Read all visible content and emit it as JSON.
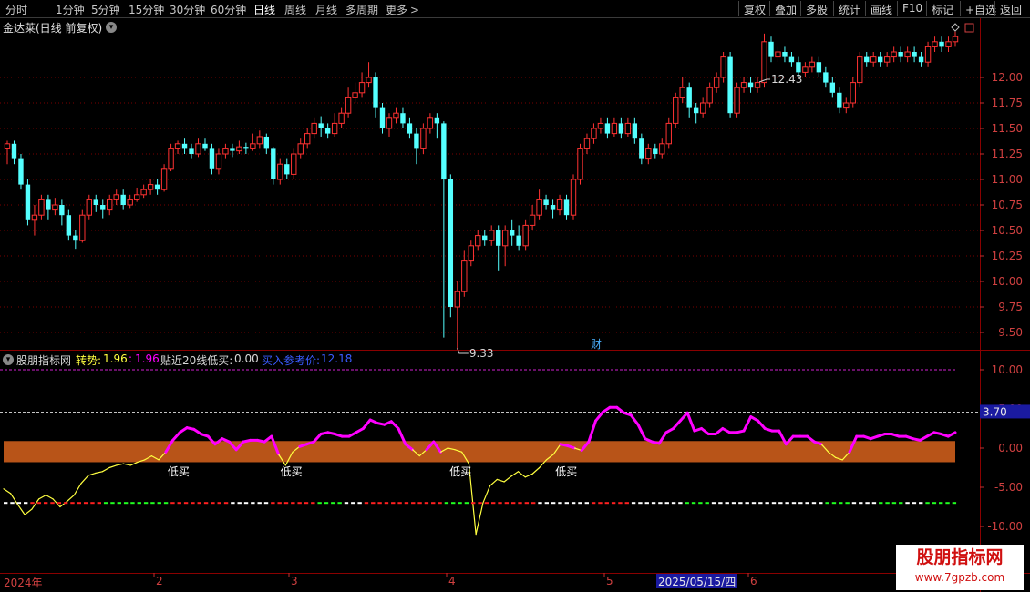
{
  "toolbar": {
    "periods": [
      "分时",
      "1分钟",
      "5分钟",
      "15分钟",
      "30分钟",
      "60分钟",
      "日线",
      "周线",
      "月线",
      "多周期",
      "更多"
    ],
    "active_period": "日线",
    "more_arrow": ">",
    "tools": [
      "复权",
      "叠加",
      "多股",
      "统计",
      "画线",
      "F10",
      "标记",
      "+自选",
      "返回"
    ]
  },
  "stock": {
    "title": "金达莱(日线 前复权)",
    "high_label": "12.43",
    "low_label": "9.33",
    "fin_marker": "财"
  },
  "price_axis": [
    "12.00",
    "11.75",
    "11.50",
    "11.25",
    "11.00",
    "10.75",
    "10.50",
    "10.25",
    "10.00",
    "9.75",
    "9.50"
  ],
  "indicator": {
    "name": "股朋指标网",
    "trend_label": "转势:",
    "trend_value_1": "1.96",
    "trend_sep": ":",
    "trend_value_2": "1.96",
    "near_label": "贴近20线低买:",
    "near_value": "0.00",
    "ref_label": "买入参考价:",
    "ref_value": "12.18",
    "axis": [
      "10.00",
      "5.00",
      "0.00",
      "-5.00",
      "-10.00"
    ],
    "current_value": "3.70",
    "signal_text": "低买"
  },
  "dates": {
    "year": "2024年",
    "months": [
      "2",
      "3",
      "4",
      "5",
      "6"
    ],
    "cursor": "2025/05/15/四"
  },
  "watermark": {
    "title": "股朋指标网",
    "url": "www.7gpzb.com"
  },
  "colors": {
    "up": "#ff3232",
    "down": "#54ffff",
    "trend_up": "#ff00ff",
    "trend_down": "#ffff40",
    "band": "#b85418",
    "grid": "#7a0000"
  },
  "chart_data": {
    "type": "candlestick",
    "price_range": [
      9.3,
      12.5
    ],
    "indicator_range": [
      -12,
      12
    ],
    "candles": [
      [
        11.3,
        11.35,
        11.38,
        11.15
      ],
      [
        11.35,
        11.2,
        11.38,
        11.15
      ],
      [
        11.2,
        10.95,
        11.25,
        10.9
      ],
      [
        10.95,
        10.6,
        11.0,
        10.55
      ],
      [
        10.6,
        10.65,
        10.75,
        10.45
      ],
      [
        10.65,
        10.8,
        10.85,
        10.6
      ],
      [
        10.8,
        10.7,
        10.85,
        10.6
      ],
      [
        10.7,
        10.75,
        10.82,
        10.65
      ],
      [
        10.75,
        10.65,
        10.8,
        10.55
      ],
      [
        10.65,
        10.45,
        10.7,
        10.4
      ],
      [
        10.45,
        10.4,
        10.5,
        10.32
      ],
      [
        10.4,
        10.65,
        10.7,
        10.38
      ],
      [
        10.65,
        10.8,
        10.85,
        10.6
      ],
      [
        10.8,
        10.75,
        10.85,
        10.68
      ],
      [
        10.75,
        10.7,
        10.8,
        10.62
      ],
      [
        10.7,
        10.8,
        10.85,
        10.65
      ],
      [
        10.8,
        10.85,
        10.9,
        10.75
      ],
      [
        10.85,
        10.75,
        10.9,
        10.7
      ],
      [
        10.75,
        10.8,
        10.85,
        10.72
      ],
      [
        10.8,
        10.85,
        10.92,
        10.78
      ],
      [
        10.85,
        10.9,
        10.95,
        10.82
      ],
      [
        10.9,
        10.95,
        11.0,
        10.85
      ],
      [
        10.95,
        10.9,
        11.0,
        10.85
      ],
      [
        10.9,
        11.1,
        11.15,
        10.88
      ],
      [
        11.1,
        11.3,
        11.35,
        11.08
      ],
      [
        11.3,
        11.35,
        11.38,
        11.25
      ],
      [
        11.35,
        11.3,
        11.4,
        11.25
      ],
      [
        11.3,
        11.25,
        11.35,
        11.2
      ],
      [
        11.25,
        11.35,
        11.4,
        11.22
      ],
      [
        11.35,
        11.3,
        11.4,
        11.28
      ],
      [
        11.3,
        11.1,
        11.35,
        11.05
      ],
      [
        11.1,
        11.25,
        11.3,
        11.05
      ],
      [
        11.25,
        11.3,
        11.35,
        11.2
      ],
      [
        11.3,
        11.28,
        11.35,
        11.22
      ],
      [
        11.28,
        11.32,
        11.38,
        11.25
      ],
      [
        11.32,
        11.3,
        11.36,
        11.25
      ],
      [
        11.3,
        11.35,
        11.45,
        11.28
      ],
      [
        11.35,
        11.42,
        11.48,
        11.3
      ],
      [
        11.42,
        11.3,
        11.45,
        11.25
      ],
      [
        11.3,
        11.0,
        11.32,
        10.95
      ],
      [
        11.0,
        11.15,
        11.2,
        10.95
      ],
      [
        11.15,
        11.05,
        11.2,
        11.0
      ],
      [
        11.05,
        11.25,
        11.3,
        11.0
      ],
      [
        11.25,
        11.35,
        11.4,
        11.2
      ],
      [
        11.35,
        11.45,
        11.5,
        11.3
      ],
      [
        11.45,
        11.55,
        11.6,
        11.4
      ],
      [
        11.55,
        11.5,
        11.62,
        11.42
      ],
      [
        11.5,
        11.45,
        11.55,
        11.4
      ],
      [
        11.45,
        11.55,
        11.65,
        11.42
      ],
      [
        11.55,
        11.65,
        11.7,
        11.5
      ],
      [
        11.65,
        11.8,
        11.9,
        11.6
      ],
      [
        11.8,
        11.85,
        11.95,
        11.75
      ],
      [
        11.85,
        11.95,
        12.05,
        11.8
      ],
      [
        11.95,
        12.0,
        12.15,
        11.9
      ],
      [
        12.0,
        11.7,
        12.05,
        11.6
      ],
      [
        11.7,
        11.5,
        11.75,
        11.45
      ],
      [
        11.5,
        11.6,
        11.65,
        11.42
      ],
      [
        11.6,
        11.65,
        11.7,
        11.55
      ],
      [
        11.65,
        11.55,
        11.7,
        11.5
      ],
      [
        11.55,
        11.45,
        11.6,
        11.4
      ],
      [
        11.45,
        11.3,
        11.5,
        11.15
      ],
      [
        11.3,
        11.5,
        11.55,
        11.25
      ],
      [
        11.5,
        11.6,
        11.65,
        11.45
      ],
      [
        11.6,
        11.55,
        11.65,
        11.4
      ],
      [
        11.55,
        11.0,
        11.57,
        9.45
      ],
      [
        11.0,
        9.75,
        11.05,
        9.65
      ],
      [
        9.75,
        9.9,
        10.0,
        9.33
      ],
      [
        9.9,
        10.2,
        10.3,
        9.85
      ],
      [
        10.2,
        10.35,
        10.4,
        10.15
      ],
      [
        10.35,
        10.45,
        10.5,
        10.3
      ],
      [
        10.45,
        10.4,
        10.5,
        10.35
      ],
      [
        10.4,
        10.5,
        10.55,
        10.35
      ],
      [
        10.5,
        10.35,
        10.55,
        10.1
      ],
      [
        10.35,
        10.5,
        10.55,
        10.15
      ],
      [
        10.5,
        10.45,
        10.6,
        10.35
      ],
      [
        10.45,
        10.35,
        10.55,
        10.3
      ],
      [
        10.35,
        10.55,
        10.6,
        10.3
      ],
      [
        10.55,
        10.65,
        10.75,
        10.5
      ],
      [
        10.65,
        10.8,
        10.9,
        10.6
      ],
      [
        10.8,
        10.75,
        10.85,
        10.7
      ],
      [
        10.75,
        10.7,
        10.8,
        10.62
      ],
      [
        10.7,
        10.8,
        10.85,
        10.65
      ],
      [
        10.8,
        10.65,
        10.85,
        10.6
      ],
      [
        10.65,
        11.0,
        11.05,
        10.6
      ],
      [
        11.0,
        11.3,
        11.35,
        10.95
      ],
      [
        11.3,
        11.4,
        11.45,
        11.25
      ],
      [
        11.4,
        11.5,
        11.55,
        11.35
      ],
      [
        11.5,
        11.55,
        11.6,
        11.45
      ],
      [
        11.55,
        11.45,
        11.6,
        11.4
      ],
      [
        11.45,
        11.55,
        11.6,
        11.42
      ],
      [
        11.55,
        11.45,
        11.6,
        11.4
      ],
      [
        11.45,
        11.55,
        11.6,
        11.42
      ],
      [
        11.55,
        11.4,
        11.6,
        11.35
      ],
      [
        11.4,
        11.2,
        11.45,
        11.15
      ],
      [
        11.2,
        11.3,
        11.35,
        11.15
      ],
      [
        11.3,
        11.25,
        11.35,
        11.2
      ],
      [
        11.25,
        11.35,
        11.4,
        11.2
      ],
      [
        11.35,
        11.55,
        11.6,
        11.3
      ],
      [
        11.55,
        11.8,
        11.85,
        11.5
      ],
      [
        11.8,
        11.9,
        12.0,
        11.75
      ],
      [
        11.9,
        11.7,
        11.95,
        11.6
      ],
      [
        11.7,
        11.65,
        11.75,
        11.55
      ],
      [
        11.65,
        11.75,
        11.8,
        11.6
      ],
      [
        11.75,
        11.9,
        11.95,
        11.7
      ],
      [
        11.9,
        12.0,
        12.05,
        11.85
      ],
      [
        12.0,
        12.2,
        12.25,
        11.95
      ],
      [
        12.2,
        11.65,
        12.25,
        11.6
      ],
      [
        11.65,
        11.9,
        11.95,
        11.6
      ],
      [
        11.9,
        11.95,
        12.0,
        11.85
      ],
      [
        11.95,
        11.9,
        12.0,
        11.85
      ],
      [
        11.9,
        11.95,
        12.0,
        11.85
      ],
      [
        11.95,
        12.35,
        12.43,
        11.9
      ],
      [
        12.35,
        12.2,
        12.4,
        12.15
      ],
      [
        12.2,
        12.25,
        12.3,
        12.15
      ],
      [
        12.25,
        12.2,
        12.3,
        12.15
      ],
      [
        12.2,
        12.15,
        12.25,
        12.1
      ],
      [
        12.15,
        12.05,
        12.2,
        12.0
      ],
      [
        12.05,
        12.1,
        12.15,
        12.0
      ],
      [
        12.1,
        12.15,
        12.2,
        12.05
      ],
      [
        12.15,
        12.05,
        12.2,
        12.0
      ],
      [
        12.05,
        11.95,
        12.1,
        11.9
      ],
      [
        11.95,
        11.85,
        12.0,
        11.8
      ],
      [
        11.85,
        11.7,
        11.9,
        11.65
      ],
      [
        11.7,
        11.75,
        11.8,
        11.65
      ],
      [
        11.75,
        11.95,
        12.0,
        11.7
      ],
      [
        11.95,
        12.2,
        12.25,
        11.9
      ],
      [
        12.2,
        12.15,
        12.25,
        12.1
      ],
      [
        12.15,
        12.2,
        12.25,
        12.1
      ],
      [
        12.2,
        12.15,
        12.25,
        12.1
      ],
      [
        12.15,
        12.2,
        12.25,
        12.1
      ],
      [
        12.2,
        12.25,
        12.3,
        12.15
      ],
      [
        12.25,
        12.2,
        12.3,
        12.15
      ],
      [
        12.2,
        12.25,
        12.3,
        12.15
      ],
      [
        12.25,
        12.2,
        12.3,
        12.15
      ],
      [
        12.2,
        12.15,
        12.25,
        12.1
      ],
      [
        12.15,
        12.3,
        12.35,
        12.1
      ],
      [
        12.3,
        12.35,
        12.4,
        12.25
      ],
      [
        12.35,
        12.3,
        12.4,
        12.25
      ],
      [
        12.3,
        12.35,
        12.4,
        12.25
      ],
      [
        12.35,
        12.4,
        12.45,
        12.3
      ]
    ],
    "indicator": [
      -5.2,
      -5.8,
      -7.2,
      -8.5,
      -7.8,
      -6.5,
      -6.0,
      -6.5,
      -7.5,
      -6.8,
      -6.0,
      -4.5,
      -3.5,
      -3.2,
      -3.0,
      -2.5,
      -2.2,
      -2.0,
      -2.2,
      -1.8,
      -1.5,
      -1.0,
      -1.5,
      -0.5,
      1.0,
      2.0,
      2.6,
      2.4,
      1.8,
      1.5,
      0.5,
      1.2,
      0.8,
      -0.2,
      0.8,
      1.0,
      1.0,
      0.8,
      1.5,
      -0.8,
      -2.2,
      -0.5,
      0.2,
      0.5,
      0.8,
      1.8,
      2.0,
      1.8,
      1.5,
      1.5,
      2.0,
      2.5,
      3.6,
      3.2,
      3.0,
      3.4,
      2.5,
      0.5,
      -0.2,
      -1.0,
      -0.2,
      0.8,
      -0.5,
      0.0,
      -0.2,
      -0.5,
      -2.0,
      -11.0,
      -7.0,
      -4.8,
      -4.0,
      -4.3,
      -3.6,
      -3.0,
      -3.7,
      -3.3,
      -2.5,
      -1.5,
      -0.8,
      0.5,
      0.3,
      0.0,
      -0.3,
      0.8,
      3.5,
      4.6,
      5.2,
      5.2,
      4.5,
      4.2,
      3.0,
      1.2,
      0.8,
      0.6,
      2.0,
      2.5,
      3.5,
      4.5,
      2.2,
      2.5,
      1.8,
      1.8,
      2.5,
      2.0,
      2.0,
      2.2,
      4.0,
      3.5,
      2.5,
      2.2,
      2.2,
      0.5,
      1.5,
      1.5,
      1.5,
      0.8,
      0.5,
      -0.5,
      -1.2,
      -1.5,
      -0.5,
      1.5,
      1.5,
      1.2,
      1.5,
      1.8,
      1.8,
      1.5,
      1.5,
      1.2,
      1.0,
      1.5,
      2.0,
      1.8,
      1.5,
      2.0
    ],
    "trend_line": [
      0,
      0,
      0,
      0,
      1,
      1,
      1,
      1,
      1,
      1,
      1,
      1,
      1,
      1,
      1,
      2,
      2,
      2,
      2,
      2,
      2,
      2,
      2,
      2,
      2,
      1,
      1,
      1,
      1,
      1,
      1,
      1,
      1,
      1,
      0,
      0,
      0,
      0,
      0,
      0,
      1,
      1,
      1,
      1,
      1,
      1,
      1,
      2,
      2,
      2,
      2,
      0,
      0,
      0,
      1,
      1,
      1,
      1,
      1,
      1,
      1,
      1,
      1,
      1,
      1,
      1,
      2,
      2,
      2,
      2,
      1,
      1,
      1,
      1,
      1,
      1,
      1,
      1,
      1,
      1,
      0,
      0,
      0,
      0,
      0,
      0,
      0,
      0,
      1,
      1,
      1,
      1,
      1,
      1,
      0,
      0,
      0,
      0,
      0,
      0,
      0,
      0,
      2,
      2,
      2,
      2,
      0,
      0,
      0,
      0,
      0,
      0,
      0,
      0,
      0,
      0,
      0,
      0,
      0,
      0,
      0,
      0,
      0,
      2,
      2,
      2,
      2,
      0,
      0,
      0,
      0,
      2,
      2,
      2,
      2,
      0,
      0,
      0,
      2,
      2,
      2,
      2,
      2
    ],
    "low_buy_signals": [
      23,
      39,
      63,
      78
    ],
    "low_index": 66,
    "high_index": 110
  }
}
